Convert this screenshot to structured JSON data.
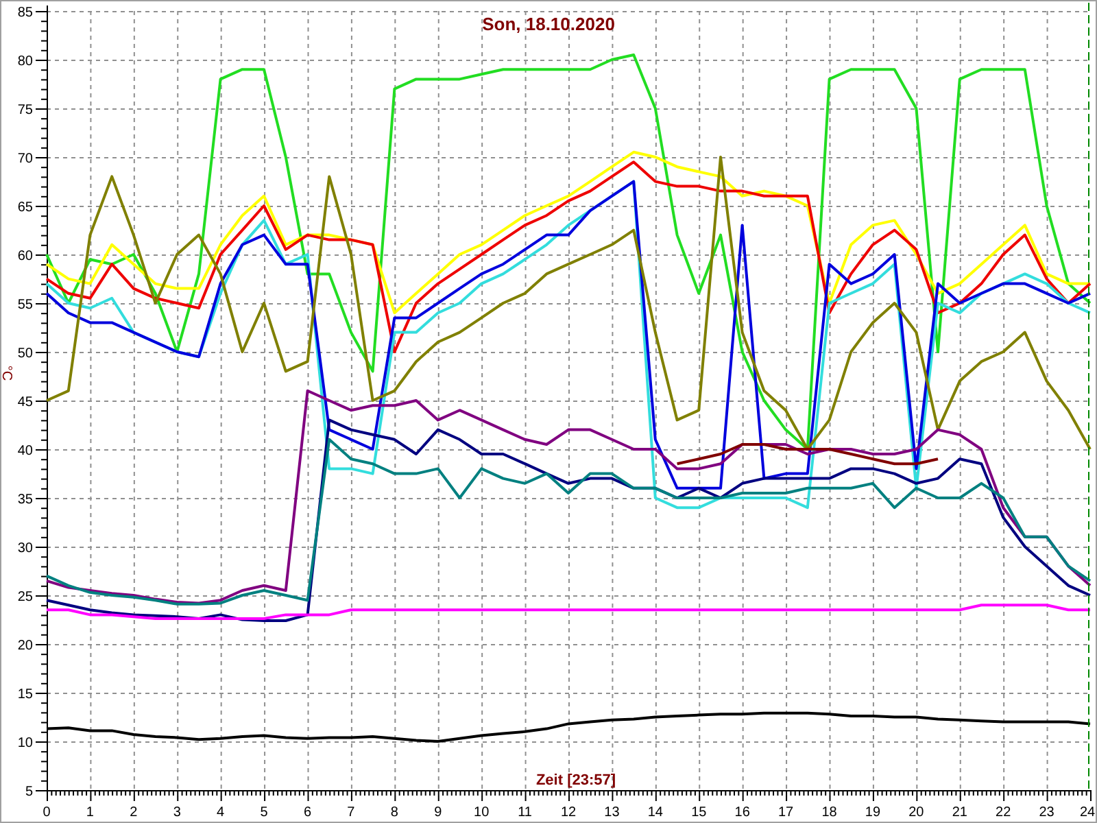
{
  "chart": {
    "chart_data": {
      "type": "line",
      "title": "Son, 18.10.2020",
      "xlabel": "Zeit [23:57]",
      "ylabel": "°C",
      "x": [
        0,
        0.5,
        1,
        1.5,
        2,
        2.5,
        3,
        3.5,
        4,
        4.5,
        5,
        5.5,
        6,
        6.5,
        7,
        7.5,
        8,
        8.5,
        9,
        9.5,
        10,
        10.5,
        11,
        11.5,
        12,
        12.5,
        13,
        13.5,
        14,
        14.5,
        15,
        15.5,
        16,
        16.5,
        17,
        17.5,
        18,
        18.5,
        19,
        19.5,
        20,
        20.5,
        21,
        21.5,
        22,
        22.5,
        23,
        23.5,
        24
      ],
      "series": [
        {
          "color": "#22dd22",
          "values": [
            60,
            55,
            59.5,
            59,
            60,
            56,
            50,
            58,
            78,
            79,
            79,
            70,
            58,
            58,
            52,
            48,
            77,
            78,
            78,
            78,
            78.5,
            79,
            79,
            79,
            79,
            79,
            80,
            80.5,
            75,
            62,
            56,
            62,
            50,
            45,
            42,
            40,
            78,
            79,
            79,
            79,
            75,
            50,
            78,
            79,
            79,
            79,
            65,
            57,
            55
          ]
        },
        {
          "color": "#ffff00",
          "values": [
            59,
            57.5,
            57,
            61,
            59,
            57,
            56.5,
            56.5,
            61,
            64,
            66,
            61,
            62,
            62,
            61.5,
            61,
            54,
            56,
            58,
            60,
            61,
            62.5,
            64,
            65,
            66,
            67.5,
            69,
            70.5,
            70,
            69,
            68.5,
            68,
            66,
            66.5,
            66,
            65,
            55,
            61,
            63,
            63.5,
            60,
            56,
            57,
            59,
            61,
            63,
            58,
            57,
            57
          ]
        },
        {
          "color": "#ee0000",
          "values": [
            57.5,
            56,
            55.5,
            59,
            56.5,
            55.5,
            55,
            54.5,
            60,
            62.5,
            65,
            60.5,
            62,
            61.5,
            61.5,
            61,
            50,
            55,
            57,
            58.5,
            60,
            61.5,
            63,
            64,
            65.5,
            66.5,
            68,
            69.5,
            67.5,
            67,
            67,
            66.5,
            66.5,
            66,
            66,
            66,
            54,
            58,
            61,
            62.5,
            60.5,
            54,
            55,
            57,
            60,
            62,
            57.5,
            55,
            57
          ]
        },
        {
          "color": "#33dddd",
          "values": [
            57,
            55,
            54.5,
            55.5,
            52,
            51,
            50,
            49.5,
            56,
            61,
            63.5,
            59,
            60,
            38,
            38,
            37.5,
            52,
            52,
            54,
            55,
            57,
            58,
            59.5,
            61,
            63,
            64.5,
            66,
            67.5,
            35,
            34,
            34,
            35,
            35,
            35,
            35,
            34,
            55,
            56,
            57,
            59,
            36,
            55,
            54,
            56,
            57,
            58,
            57,
            55,
            54
          ]
        },
        {
          "color": "#0000dd",
          "values": [
            56,
            54,
            53,
            53,
            52,
            51,
            50,
            49.5,
            57,
            61,
            62,
            59,
            59,
            42,
            41,
            40,
            53.5,
            53.5,
            55,
            56.5,
            58,
            59,
            60.5,
            62,
            62,
            64.5,
            66,
            67.5,
            41,
            36,
            36,
            36,
            63,
            37,
            37.5,
            37.5,
            59,
            57,
            58,
            60,
            38,
            57,
            55,
            56,
            57,
            57,
            56,
            55,
            56
          ]
        },
        {
          "color": "#808000",
          "values": [
            45,
            46,
            62,
            68,
            62,
            55,
            60,
            62,
            58,
            50,
            55,
            48,
            49,
            68,
            60,
            45,
            46,
            49,
            51,
            52,
            53.5,
            55,
            56,
            58,
            59,
            60,
            61,
            62.5,
            52,
            43,
            44,
            70,
            52,
            46,
            44,
            40,
            43,
            50,
            53,
            55,
            52,
            42,
            47,
            49,
            50,
            52,
            47,
            44,
            40
          ]
        },
        {
          "color": "#800080",
          "values": [
            26.5,
            25.8,
            25.5,
            25.2,
            25,
            24.6,
            24.3,
            24.2,
            24.5,
            25.5,
            26,
            25.5,
            46,
            45,
            44,
            44.5,
            44.5,
            45,
            43,
            44,
            43,
            42,
            41,
            40.5,
            42,
            42,
            41,
            40,
            40,
            38,
            38,
            38.5,
            40.5,
            40.5,
            40.5,
            39.5,
            40,
            40,
            39.5,
            39.5,
            40,
            42,
            41.5,
            40,
            34,
            31,
            31,
            28,
            26
          ]
        },
        {
          "color": "#800000",
          "values": [
            null,
            null,
            null,
            null,
            null,
            null,
            null,
            null,
            null,
            null,
            null,
            null,
            null,
            null,
            null,
            null,
            null,
            null,
            null,
            null,
            null,
            null,
            null,
            null,
            null,
            null,
            null,
            null,
            null,
            38.5,
            39,
            39.5,
            40.5,
            40.5,
            40,
            40,
            40,
            39.5,
            39,
            38.5,
            38.5,
            39,
            null,
            null,
            null,
            null,
            null,
            null,
            null
          ]
        },
        {
          "color": "#000080",
          "values": [
            24.5,
            24,
            23.5,
            23.2,
            23,
            22.9,
            22.8,
            22.6,
            23,
            22.5,
            22.4,
            22.4,
            23,
            43,
            42,
            41.5,
            41,
            39.5,
            42,
            41,
            39.5,
            39.5,
            38.5,
            37.5,
            36.5,
            37,
            37,
            36,
            36,
            35,
            36,
            35,
            36.5,
            37,
            37,
            37,
            37,
            38,
            38,
            37.5,
            36.5,
            37,
            39,
            38.5,
            33,
            30,
            28,
            26,
            25
          ]
        },
        {
          "color": "#008080",
          "values": [
            27,
            26,
            25.3,
            25,
            24.8,
            24.5,
            24.1,
            24.1,
            24.2,
            25,
            25.5,
            25,
            24.5,
            41,
            39,
            38.5,
            37.5,
            37.5,
            38,
            35,
            38,
            37,
            36.5,
            37.5,
            35.5,
            37.5,
            37.5,
            36,
            36,
            35,
            35,
            35,
            35.5,
            35.5,
            35.5,
            36,
            36,
            36,
            36.5,
            34,
            36,
            35,
            35,
            36.5,
            35,
            31,
            31,
            28,
            26.5
          ]
        },
        {
          "color": "#ff00ff",
          "values": [
            23.5,
            23.5,
            23,
            23,
            22.8,
            22.6,
            22.6,
            22.6,
            22.6,
            22.6,
            22.6,
            23,
            23,
            23,
            23.5,
            23.5,
            23.5,
            23.5,
            23.5,
            23.5,
            23.5,
            23.5,
            23.5,
            23.5,
            23.5,
            23.5,
            23.5,
            23.5,
            23.5,
            23.5,
            23.5,
            23.5,
            23.5,
            23.5,
            23.5,
            23.5,
            23.5,
            23.5,
            23.5,
            23.5,
            23.5,
            23.5,
            23.5,
            24,
            24,
            24,
            24,
            23.5,
            23.5
          ]
        },
        {
          "color": "#000000",
          "values": [
            11.3,
            11.4,
            11.1,
            11.1,
            10.7,
            10.5,
            10.4,
            10.2,
            10.3,
            10.5,
            10.6,
            10.4,
            10.3,
            10.4,
            10.4,
            10.5,
            10.3,
            10.1,
            10,
            10.3,
            10.6,
            10.8,
            11,
            11.3,
            11.8,
            12,
            12.2,
            12.3,
            12.5,
            12.6,
            12.7,
            12.8,
            12.8,
            12.9,
            12.9,
            12.9,
            12.8,
            12.6,
            12.6,
            12.5,
            12.5,
            12.3,
            12.2,
            12.1,
            12,
            12,
            12,
            12,
            11.8
          ]
        }
      ],
      "xlim": [
        0,
        24
      ],
      "ylim": [
        5,
        85
      ],
      "xticks": [
        0,
        1,
        2,
        3,
        4,
        5,
        6,
        7,
        8,
        9,
        10,
        11,
        12,
        13,
        14,
        15,
        16,
        17,
        18,
        19,
        20,
        21,
        22,
        23,
        24
      ],
      "yticks": [
        5,
        10,
        15,
        20,
        25,
        30,
        35,
        40,
        45,
        50,
        55,
        60,
        65,
        70,
        75,
        80,
        85
      ],
      "grid": true
    }
  }
}
